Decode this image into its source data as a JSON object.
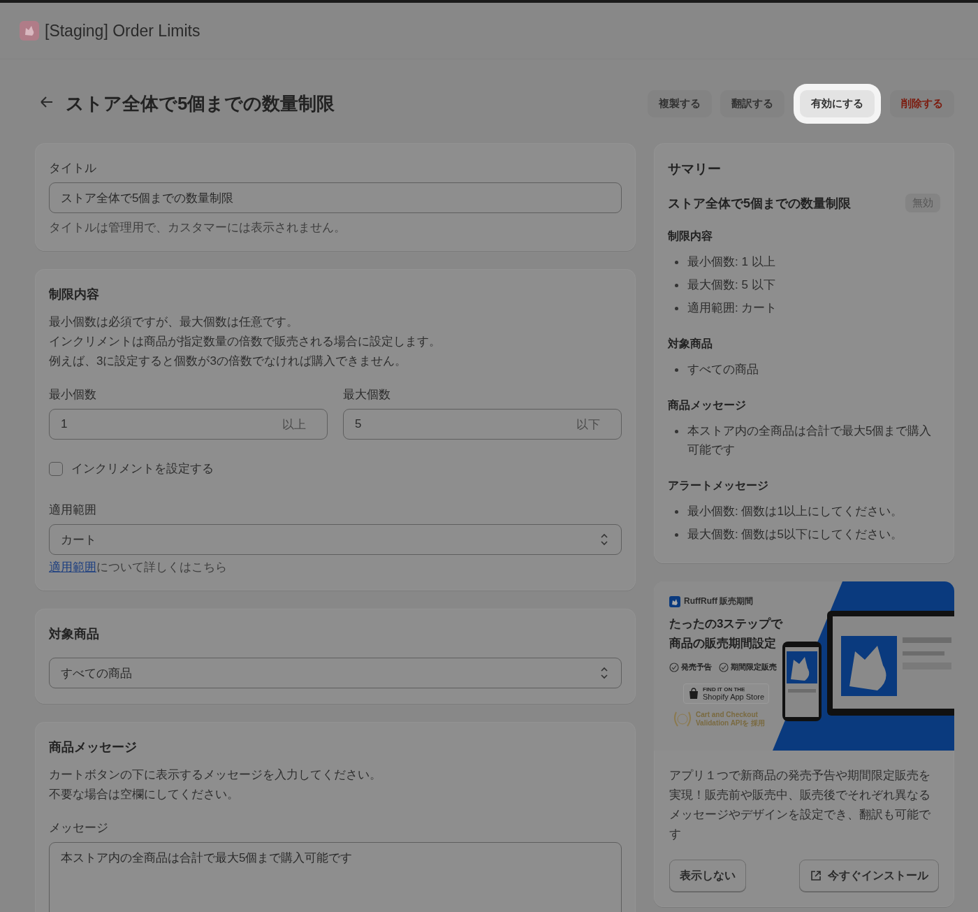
{
  "app": {
    "title": "[Staging] Order Limits"
  },
  "page": {
    "title": "ストア全体で5個までの数量制限"
  },
  "actions": [
    {
      "label": "複製する",
      "kind": "secondary"
    },
    {
      "label": "翻訳する",
      "kind": "secondary"
    },
    {
      "label": "有効にする",
      "kind": "highlighted"
    },
    {
      "label": "削除する",
      "kind": "critical"
    }
  ],
  "title_card": {
    "label": "タイトル",
    "value": "ストア全体で5個までの数量制限",
    "help": "タイトルは管理用で、カスタマーには表示されません。"
  },
  "limits_card": {
    "heading": "制限内容",
    "description": [
      "最小個数は必須ですが、最大個数は任意です。",
      "インクリメントは商品が指定数量の倍数で販売される場合に設定します。",
      "例えば、3に設定すると個数が3の倍数でなければ購入できません。"
    ],
    "min": {
      "label": "最小個数",
      "value": "1",
      "suffix": "以上"
    },
    "max": {
      "label": "最大個数",
      "value": "5",
      "suffix": "以下"
    },
    "increment": {
      "label": "インクリメントを設定する",
      "checked": false
    },
    "scope": {
      "label": "適用範囲",
      "value": "カート"
    },
    "scope_help": {
      "link": "適用範囲",
      "text": "について詳しくはこちら"
    }
  },
  "products_card": {
    "heading": "対象商品",
    "value": "すべての商品"
  },
  "message_card": {
    "heading": "商品メッセージ",
    "description": [
      "カートボタンの下に表示するメッセージを入力してください。",
      "不要な場合は空欄にしてください。"
    ],
    "label": "メッセージ",
    "value": "本ストア内の全商品は合計で最大5個まで購入可能です"
  },
  "summary": {
    "heading": "サマリー",
    "rule_title": "ストア全体で5個までの数量制限",
    "status": "無効",
    "sections": [
      {
        "heading": "制限内容",
        "items": [
          "最小個数: 1 以上",
          "最大個数: 5 以下",
          "適用範囲: カート"
        ]
      },
      {
        "heading": "対象商品",
        "items": [
          "すべての商品"
        ]
      },
      {
        "heading": "商品メッセージ",
        "items": [
          "本ストア内の全商品は合計で最大5個まで購入可能です"
        ]
      },
      {
        "heading": "アラートメッセージ",
        "items": [
          "最小個数: 個数は1以上にしてください。",
          "最大個数: 個数は5以下にしてください。"
        ]
      }
    ]
  },
  "promo": {
    "brand": "RuffRuff 販売期間",
    "headline": [
      "たったの3ステップで",
      "商品の販売期間設定"
    ],
    "features": [
      "発売予告",
      "期間限定販売"
    ],
    "store_badge": {
      "small": "FIND IT ON THE",
      "large": "Shopify App Store"
    },
    "award": [
      "Cart and Checkout",
      "Validation APIを 採用"
    ],
    "description": "アプリ１つで新商品の発売予告や期間限定販売を実現！販売前や販売中、販売後でそれぞれ異なるメッセージやデザインを設定でき、翻訳も可能です",
    "buttons": [
      {
        "label": "表示しない",
        "kind": "plain"
      },
      {
        "label": "今すぐインストール",
        "kind": "external"
      }
    ]
  }
}
